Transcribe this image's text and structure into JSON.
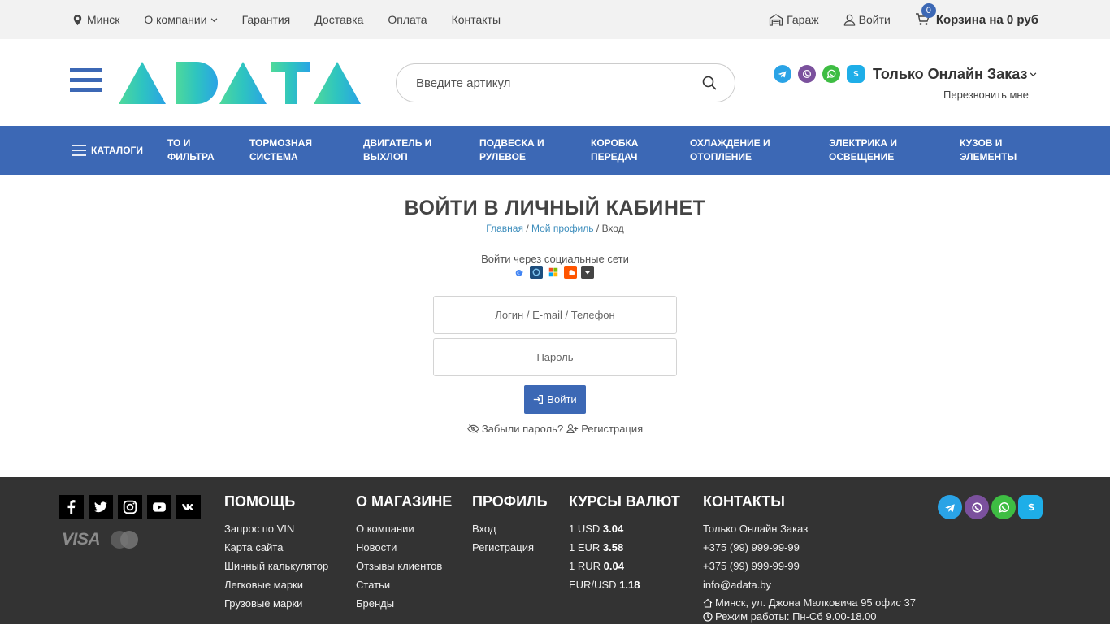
{
  "topbar": {
    "city": "Минск",
    "links": [
      "О компании",
      "Гарантия",
      "Доставка",
      "Оплата",
      "Контакты"
    ],
    "garage": "Гараж",
    "login": "Войти",
    "cart_count": "0",
    "cart_text": "Корзина на 0 руб"
  },
  "header": {
    "logo_text": "ADATA",
    "search_placeholder": "Введите артикул",
    "online_order": "Только Онлайн Заказ",
    "callback": "Перезвонить мне"
  },
  "nav": {
    "catalog": "КАТАЛОГИ",
    "items": [
      [
        "ТО И",
        "ФИЛЬТРА"
      ],
      [
        "ТОРМОЗНАЯ",
        "СИСТЕМА"
      ],
      [
        "ДВИГАТЕЛЬ И",
        "ВЫХЛОП"
      ],
      [
        "ПОДВЕСКА И",
        "РУЛЕВОЕ"
      ],
      [
        "КОРОБКА",
        "ПЕРЕДАЧ"
      ],
      [
        "ОХЛАЖДЕНИЕ И",
        "ОТОПЛЕНИЕ"
      ],
      [
        "ЭЛЕКТРИКА И",
        "ОСВЕЩЕНИЕ"
      ],
      [
        "КУЗОВ И",
        "ЭЛЕМЕНТЫ"
      ]
    ]
  },
  "page": {
    "title": "ВОЙТИ В ЛИЧНЫЙ КАБИНЕТ",
    "breadcrumb": {
      "home": "Главная",
      "profile": "Мой профиль",
      "current": "Вход",
      "sep": "/"
    },
    "social_label": "Войти через социальные сети",
    "login_placeholder": "Логин / E-mail / Телефон",
    "password_placeholder": "Пароль",
    "login_button": "Войти",
    "forgot": "Забыли пароль?",
    "register": "Регистрация"
  },
  "footer": {
    "payment": {
      "visa": "VISA"
    },
    "help": {
      "title": "ПОМОЩЬ",
      "items": [
        "Запрос по VIN",
        "Карта сайта",
        "Шинный калькулятор",
        "Легковые марки",
        "Грузовые марки"
      ]
    },
    "about": {
      "title": "О МАГАЗИНЕ",
      "items": [
        "О компании",
        "Новости",
        "Отзывы клиентов",
        "Статьи",
        "Бренды"
      ]
    },
    "profile": {
      "title": "ПРОФИЛЬ",
      "items": [
        "Вход",
        "Регистрация"
      ]
    },
    "rates": {
      "title": "КУРСЫ ВАЛЮТ",
      "items": [
        {
          "label": "1 USD",
          "value": "3.04"
        },
        {
          "label": "1 EUR",
          "value": "3.58"
        },
        {
          "label": "1 RUR",
          "value": "0.04"
        },
        {
          "label": "EUR/USD",
          "value": "1.18"
        }
      ]
    },
    "contacts": {
      "title": "КОНТАКТЫ",
      "online": "Только Онлайн Заказ",
      "phone1": "+375 (99) 999-99-99",
      "phone2": "+375 (99) 999-99-99",
      "email": "info@adata.by",
      "address": "Минск, ул. Джона Малковича 95 офис 37",
      "hours": "Режим работы: Пн-Сб 9.00-18.00"
    }
  },
  "colors": {
    "primary": "#3c68b5",
    "footer": "#333333",
    "topbar": "#f2f2f2",
    "link": "#3c8dbc"
  }
}
